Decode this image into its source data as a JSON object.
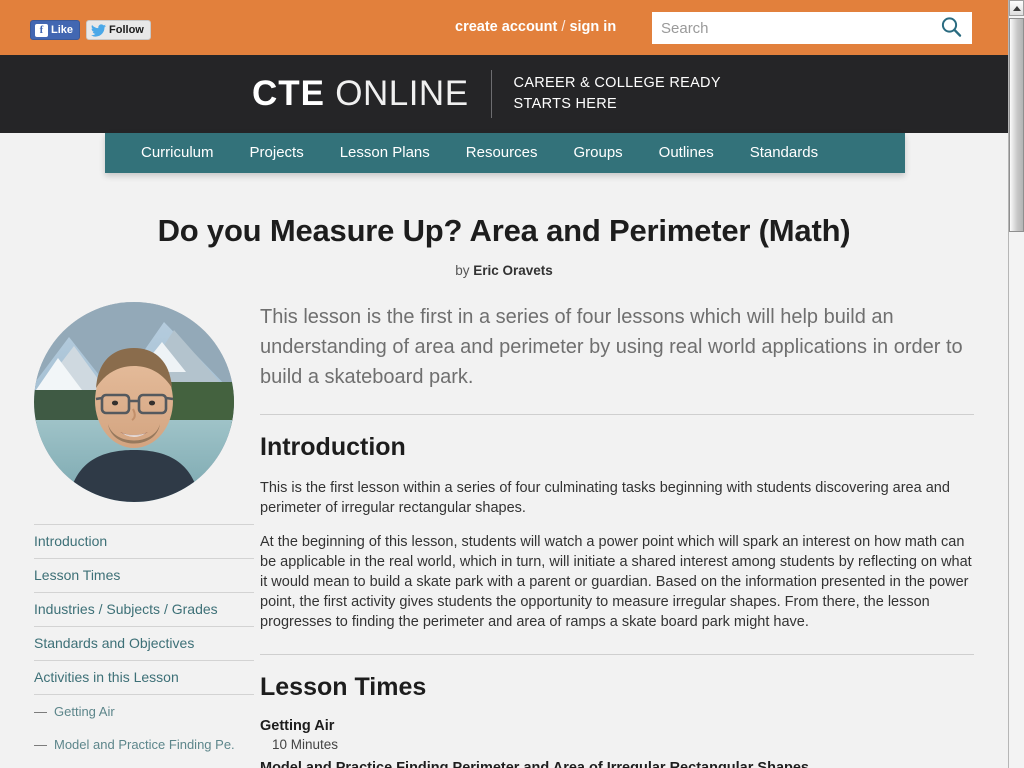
{
  "topbar": {
    "facebook_label": "Like",
    "facebook_glyph": "f",
    "twitter_label": "Follow",
    "create_account_label": "create account",
    "separator": " / ",
    "sign_in_label": "sign in",
    "search_placeholder": "Search",
    "search_value": "",
    "search_icon": "search-icon",
    "background_color": "#e2803c"
  },
  "header": {
    "logo_bold": "CTE",
    "logo_light": "ONLINE",
    "tagline_line1": "CAREER & COLLEGE READY",
    "tagline_line2": "STARTS HERE",
    "background_color": "#252527"
  },
  "nav": {
    "background_color": "#33727a",
    "items": [
      {
        "label": "Curriculum"
      },
      {
        "label": "Projects"
      },
      {
        "label": "Lesson Plans"
      },
      {
        "label": "Resources"
      },
      {
        "label": "Groups"
      },
      {
        "label": "Outlines"
      },
      {
        "label": "Standards"
      }
    ]
  },
  "page": {
    "title": "Do you Measure Up? Area and Perimeter (Math)",
    "by_label": "by",
    "author": "Eric Oravets",
    "lead": "This lesson is the first in a series of four lessons which will help build an understanding of area and perimeter by using real world applications in order to build a skateboard park."
  },
  "sidebar": {
    "avatar_alt": "Profile photo of Eric Oravets in front of a mountain lake",
    "toc": [
      {
        "label": "Introduction",
        "sub": false
      },
      {
        "label": "Lesson Times",
        "sub": false
      },
      {
        "label": "Industries / Subjects / Grades",
        "sub": false
      },
      {
        "label": "Standards and Objectives",
        "sub": false
      },
      {
        "label": "Activities in this Lesson",
        "sub": false
      },
      {
        "label": "Getting Air",
        "sub": true,
        "dash": "—"
      },
      {
        "label": "Model and Practice Finding Pe.",
        "sub": true,
        "dash": "—"
      }
    ]
  },
  "sections": {
    "introduction": {
      "heading": "Introduction",
      "paragraphs": [
        "This is the first lesson within a series of four culminating tasks beginning with students discovering area and perimeter of irregular rectangular shapes.",
        "At the beginning of this lesson, students will watch a power point which will spark an interest on how math can be applicable in the real world, which in turn, will initiate a shared interest among students by reflecting on what it would mean to build a skate park with a parent or guardian. Based on the information presented in the power point, the first activity gives students the opportunity to measure irregular shapes. From there, the lesson progresses to finding the perimeter and area of ramps a skate board park might have."
      ]
    },
    "lesson_times": {
      "heading": "Lesson Times",
      "entries": [
        {
          "name": "Getting Air",
          "duration": "10 Minutes"
        },
        {
          "name": "Model and Practice Finding Perimeter and Area of Irregular Rectangular Shapes",
          "duration": ""
        }
      ]
    }
  },
  "scrollbar": {
    "up_arrow_icon": "scroll-up-arrow-icon",
    "position_percent": 0
  }
}
